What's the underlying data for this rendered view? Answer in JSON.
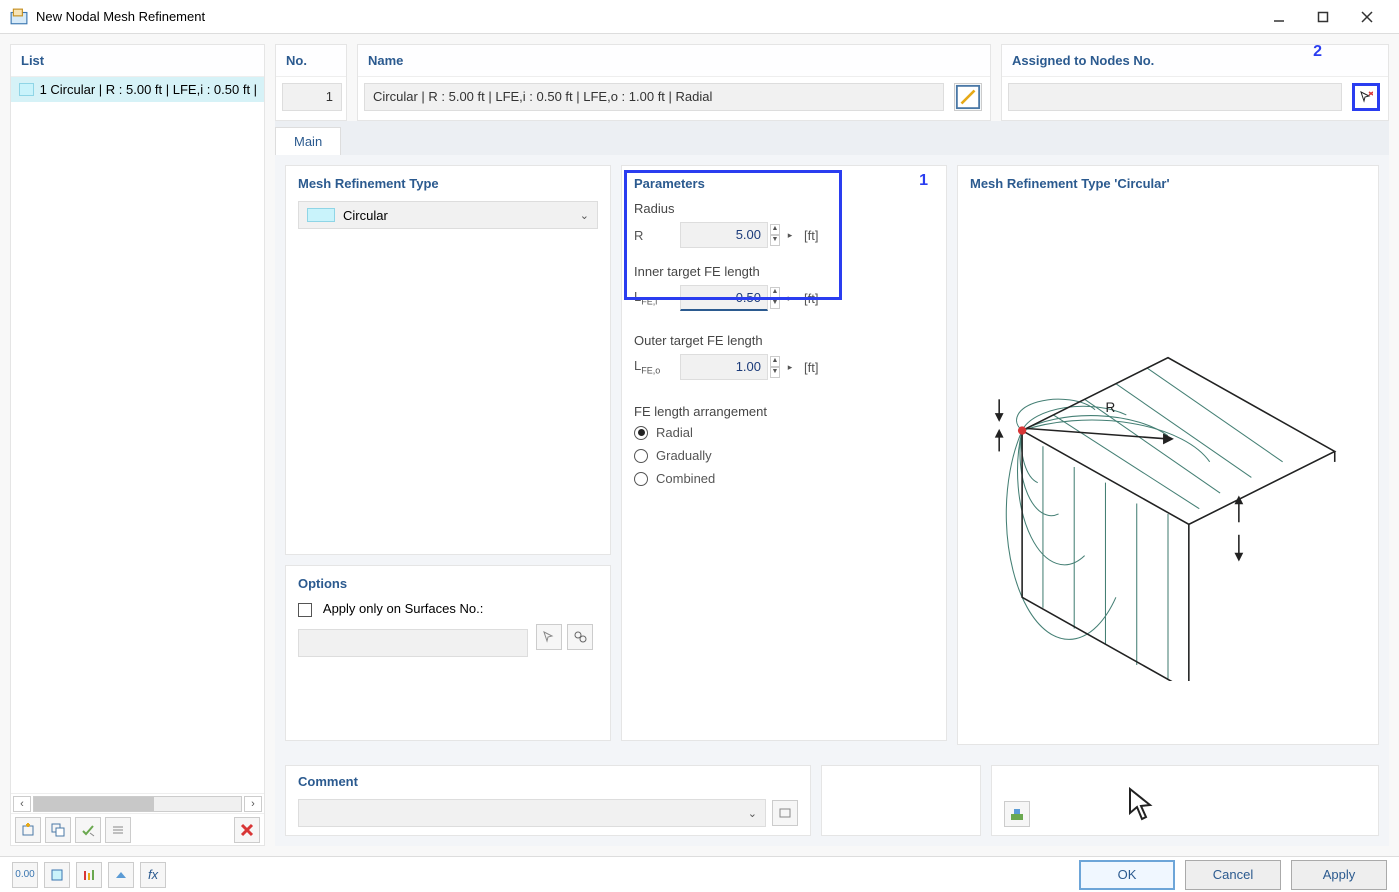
{
  "window": {
    "title": "New Nodal Mesh Refinement"
  },
  "list": {
    "header": "List",
    "item1": "1 Circular | R : 5.00 ft | LFE,i : 0.50 ft | L…"
  },
  "no": {
    "header": "No.",
    "value": "1"
  },
  "name": {
    "header": "Name",
    "value": "Circular | R : 5.00 ft | LFE,i : 0.50 ft | LFE,o : 1.00 ft | Radial"
  },
  "assigned": {
    "header": "Assigned to Nodes No.",
    "value": ""
  },
  "annot2": "2",
  "tabs": {
    "main": "Main"
  },
  "typepanel": {
    "header": "Mesh Refinement Type",
    "value": "Circular"
  },
  "params": {
    "header": "Parameters",
    "annot1": "1",
    "radius_label": "Radius",
    "r_sym": "R",
    "r_val": "5.00",
    "inner_label": "Inner target FE length",
    "lfei_sym": "LFE,i",
    "lfei_val": "0.50",
    "outer_label": "Outer target FE length",
    "lfeo_sym": "LFE,o",
    "lfeo_val": "1.00",
    "unit": "[ft]",
    "arr_label": "FE length arrangement",
    "radial": "Radial",
    "gradually": "Gradually",
    "combined": "Combined"
  },
  "options": {
    "header": "Options",
    "apply_label": "Apply only on Surfaces No.:"
  },
  "preview": {
    "header": "Mesh Refinement Type 'Circular'",
    "r_label": "R"
  },
  "comment": {
    "header": "Comment"
  },
  "buttons": {
    "ok": "OK",
    "cancel": "Cancel",
    "apply": "Apply"
  },
  "footer_icons": {
    "i1": "0.00"
  }
}
